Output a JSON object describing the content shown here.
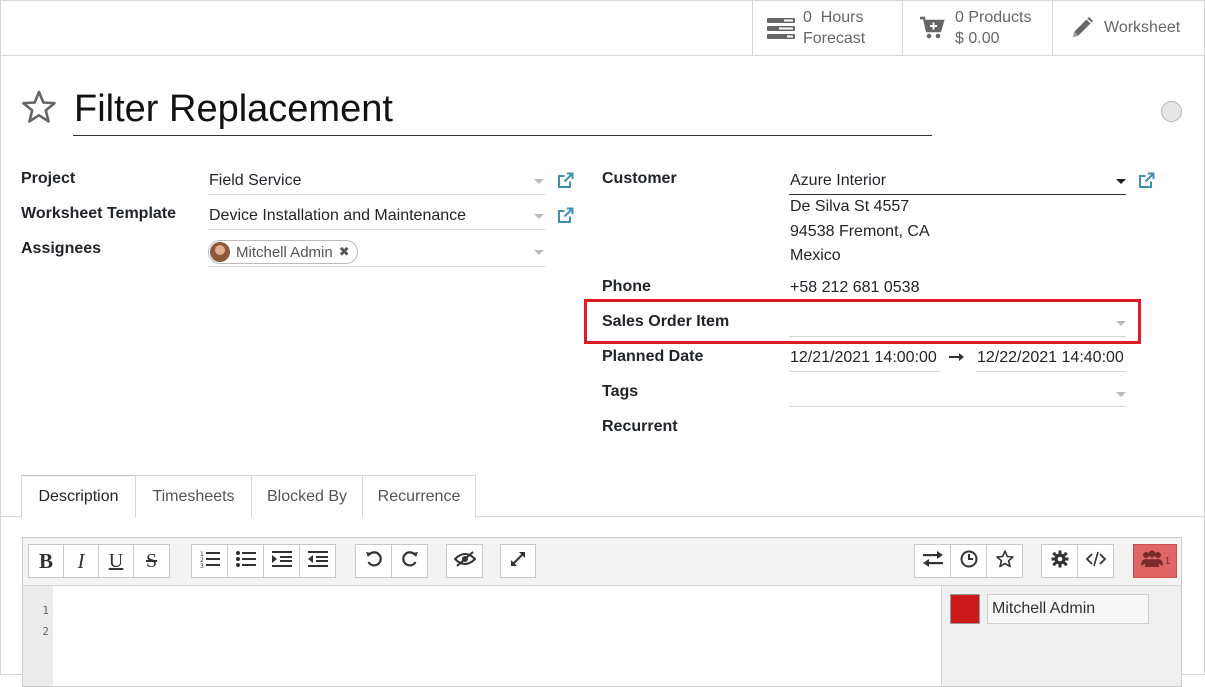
{
  "stats": {
    "hours_value": "0",
    "hours_label": "Hours",
    "hours_sub": "Forecast",
    "products_value": "0",
    "products_label": "Products",
    "products_amount": "$ 0.00",
    "worksheet_label": "Worksheet"
  },
  "title": "Filter Replacement",
  "left": {
    "project_label": "Project",
    "project_value": "Field Service",
    "template_label": "Worksheet Template",
    "template_value": "Device Installation and Maintenance",
    "assignees_label": "Assignees",
    "assignee_tag": "Mitchell Admin"
  },
  "right": {
    "customer_label": "Customer",
    "customer_value": "Azure Interior",
    "address_line1": "De Silva St 4557",
    "address_line2": "94538 Fremont, CA",
    "address_line3": "Mexico",
    "phone_label": "Phone",
    "phone_value": "+58 212 681 0538",
    "sales_order_label": "Sales Order Item",
    "sales_order_value": "",
    "planned_label": "Planned Date",
    "planned_start": "12/21/2021 14:00:00",
    "planned_end": "12/22/2021 14:40:00",
    "tags_label": "Tags",
    "recurrent_label": "Recurrent"
  },
  "tabs": [
    {
      "label": "Description",
      "active": true
    },
    {
      "label": "Timesheets",
      "active": false
    },
    {
      "label": "Blocked By",
      "active": false
    },
    {
      "label": "Recurrence",
      "active": false
    }
  ],
  "editor": {
    "line_numbers": [
      "1",
      "2"
    ],
    "collaborator": "Mitchell Admin",
    "collaborator_color": "#cc1a1a",
    "collab_count": "1"
  },
  "colors": {
    "highlight": "#dc1e24",
    "collab_button": "#e06666"
  }
}
